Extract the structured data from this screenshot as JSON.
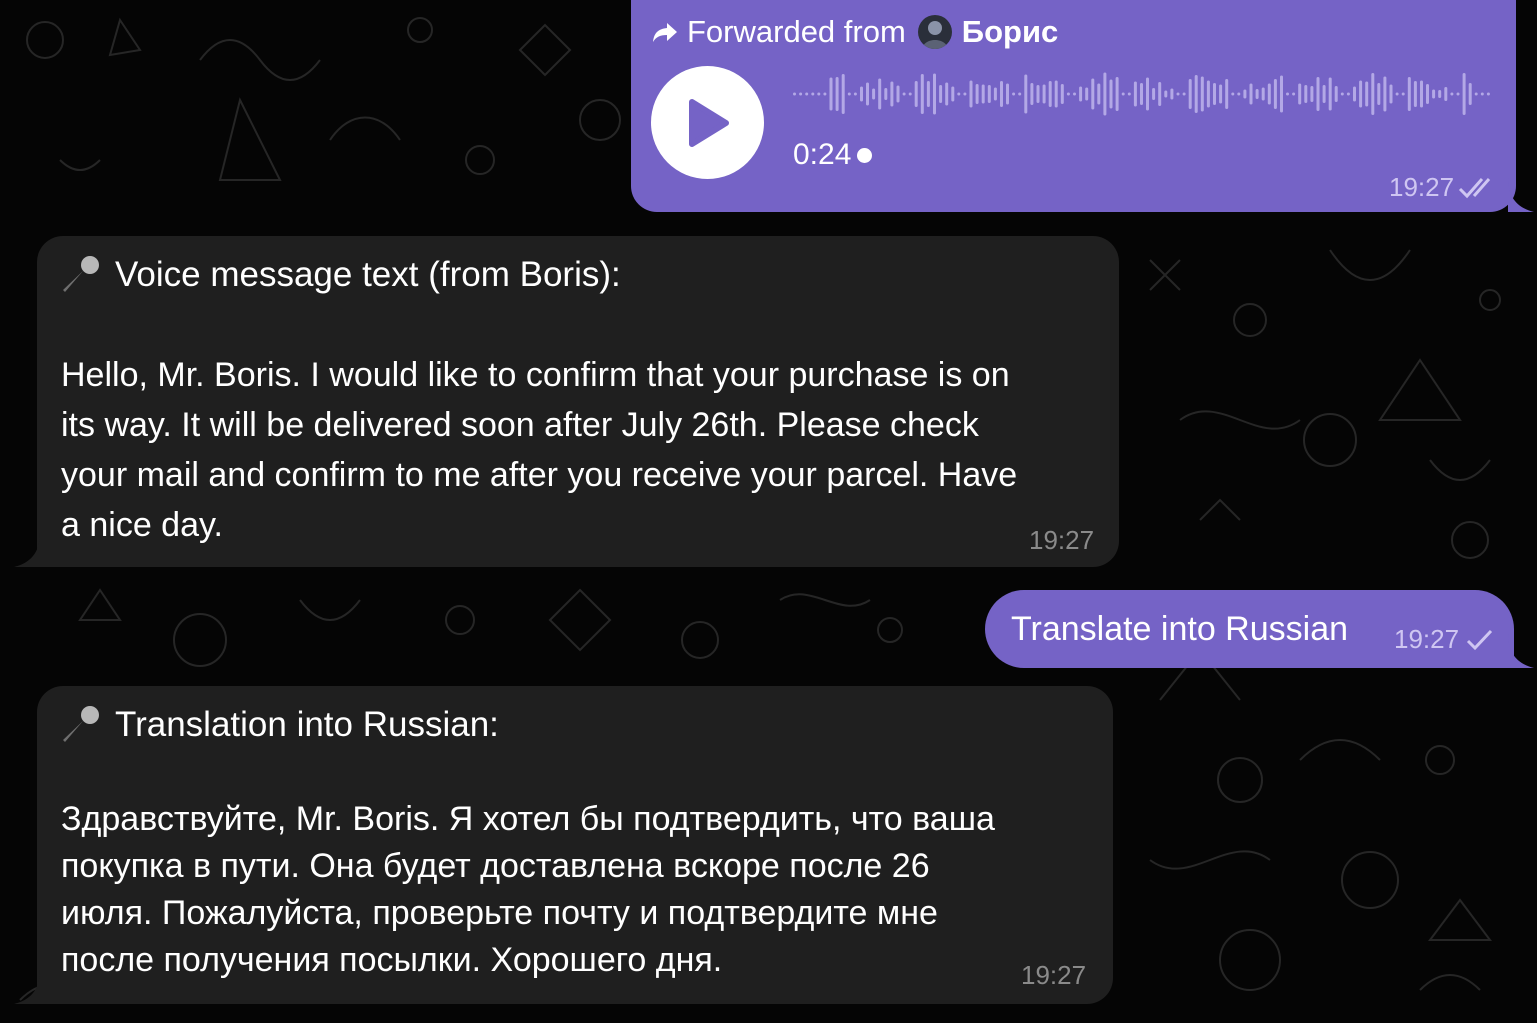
{
  "messages": {
    "forwarded_voice": {
      "forwarded_prefix": "Forwarded from",
      "sender": "Борис",
      "duration": "0:24",
      "time": "19:27",
      "status": "read"
    },
    "voice_text": {
      "title": "Voice message text (from Boris):",
      "body": "Hello, Mr. Boris. I would like to confirm that your purchase is on\nits way. It will be delivered soon after July 26th. Please check\nyour mail and confirm to me after you receive your parcel. Have\na nice day.",
      "time": "19:27"
    },
    "translate_request": {
      "text": "Translate into Russian",
      "time": "19:27",
      "status": "sent"
    },
    "translation": {
      "title": "Translation into Russian:",
      "body": "Здравствуйте, Mr. Boris. Я хотел бы подтвердить, что ваша\nпокупка в пути. Она будет доставлена вскоре после 26\nиюля. Пожалуйста, проверьте почту и подтвердите мне\nпосле получения посылки. Хорошего дня.",
      "time": "19:27"
    }
  },
  "icons": {
    "forward": "forward-arrow-icon",
    "play": "play-icon",
    "mic": "microphone-icon",
    "read": "double-check-icon",
    "sent": "single-check-icon"
  },
  "colors": {
    "outgoing_bubble": "#7563c6",
    "incoming_bubble": "#1f1f1f",
    "background": "#050505"
  }
}
